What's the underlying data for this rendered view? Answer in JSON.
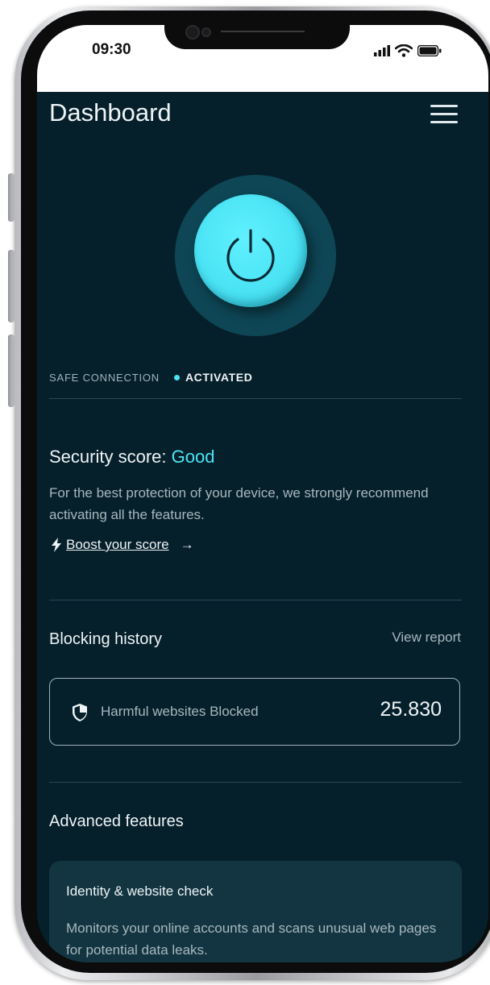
{
  "status_bar": {
    "time": "09:30",
    "icons": [
      "cellular-signal-icon",
      "wifi-icon",
      "battery-icon"
    ]
  },
  "header": {
    "title": "Dashboard",
    "menu_icon": "hamburger-menu-icon"
  },
  "power": {
    "icon": "power-icon",
    "accent_color": "#4be4f5"
  },
  "connection": {
    "label": "SAFE CONNECTION",
    "status": "ACTIVATED"
  },
  "security": {
    "title_prefix": "Security score:",
    "score": "Good",
    "description": "For the best protection of your device, we strongly recommend activating all the features.",
    "boost_label": "Boost your score",
    "boost_icon": "lightning-bolt-icon",
    "arrow": "→"
  },
  "blocking_history": {
    "title": "Blocking history",
    "view_report_label": "View report",
    "shield_icon": "shield-icon",
    "label": "Harmful websites Blocked",
    "count": "25.830"
  },
  "advanced": {
    "title": "Advanced features",
    "features": [
      {
        "title": "Identity & website check",
        "description": "Monitors your online accounts and scans unusual web pages for potential data leaks."
      }
    ]
  },
  "colors": {
    "background": "#06202b",
    "card": "#133541",
    "accent": "#4be4f5"
  }
}
